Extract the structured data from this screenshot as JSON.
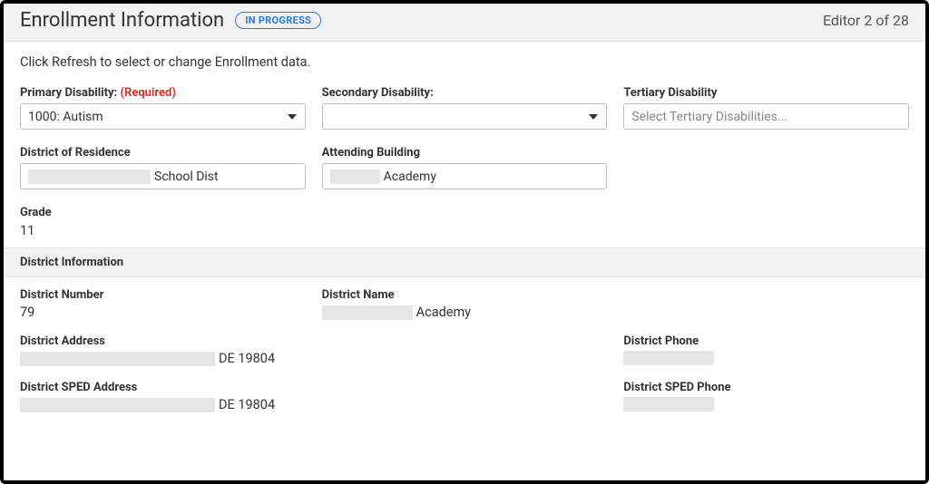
{
  "header": {
    "title": "Enrollment Information",
    "status": "IN PROGRESS",
    "editor_counter": "Editor 2 of 28"
  },
  "helper_text": "Click Refresh to select or change Enrollment data.",
  "fields": {
    "primary_disability": {
      "label": "Primary Disability:",
      "required_tag": "(Required)",
      "value": "1000: Autism"
    },
    "secondary_disability": {
      "label": "Secondary Disability:",
      "value": ""
    },
    "tertiary_disability": {
      "label": "Tertiary Disability",
      "placeholder": "Select Tertiary Disabilities..."
    },
    "district_of_residence": {
      "label": "District of Residence",
      "suffix": "School Dist"
    },
    "attending_building": {
      "label": "Attending Building",
      "suffix": "Academy"
    },
    "grade": {
      "label": "Grade",
      "value": "11"
    }
  },
  "district_info": {
    "section_title": "District Information",
    "number": {
      "label": "District Number",
      "value": "79"
    },
    "name": {
      "label": "District Name",
      "suffix": "Academy"
    },
    "address": {
      "label": "District Address",
      "suffix": "DE 19804"
    },
    "phone": {
      "label": "District Phone"
    },
    "sped_address": {
      "label": "District SPED Address",
      "suffix": "DE 19804"
    },
    "sped_phone": {
      "label": "District SPED Phone"
    }
  }
}
